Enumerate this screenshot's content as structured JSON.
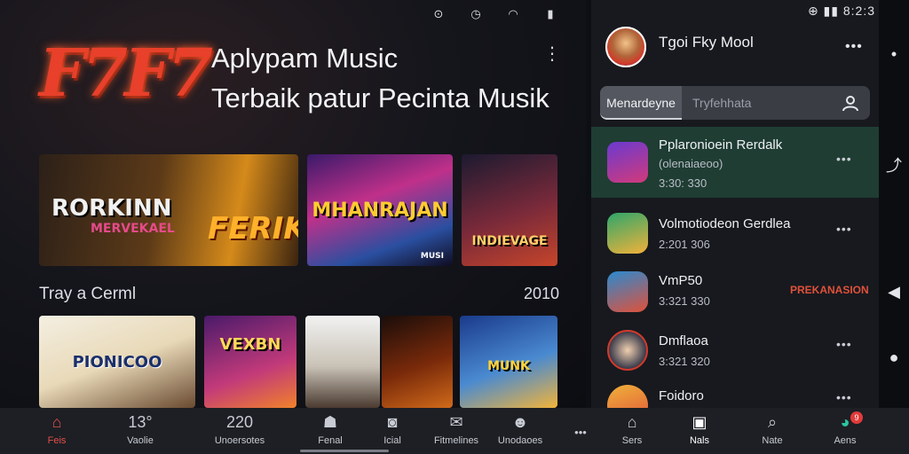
{
  "status_left": [
    "⊙",
    "◷",
    "◠",
    "▮"
  ],
  "status_right": "⊕ ▮▮ 8:2:3",
  "logo": "F7F7",
  "app": {
    "title_line1": "Aplypam Music",
    "title_line2": "Terbaik patur Pecinta Musik"
  },
  "featured": [
    {
      "title": "RORKINN",
      "subtitle": "MERVEKAEL",
      "overlay": "FERIK"
    },
    {
      "title": "MHANRAJAN",
      "tag": "MUSI"
    },
    {
      "title": "INDIEVAGE"
    }
  ],
  "section": {
    "label": "Tray a Cerml",
    "count": "2010"
  },
  "tiles": [
    {
      "title": "PIONICOO"
    },
    {
      "title": "VEXBN"
    },
    {
      "title": ""
    },
    {
      "title": ""
    },
    {
      "title": "MUNK"
    }
  ],
  "profile": {
    "name": "Tgoi Fky Mool"
  },
  "tabs": {
    "active": "Menardeyne",
    "inactive": "Tryfehhata"
  },
  "list": [
    {
      "title": "Pplaronioein Rerdalk",
      "sub": "(olenaiaeoo)",
      "sub2": "3:30: 330"
    },
    {
      "title": "Volmotiodeon Gerdlea",
      "sub": "2:201 306"
    },
    {
      "title": "VmP50",
      "sub": "3:321 330",
      "badge": "PREKANASION"
    },
    {
      "title": "Dmflaoa",
      "sub": "3:321 320"
    },
    {
      "title": "Foidoro"
    }
  ],
  "bottom_nav": [
    {
      "label": "Feis",
      "icon": "⌂"
    },
    {
      "label": "Vaolie",
      "icon": "13°"
    },
    {
      "label": "Unoersotes",
      "icon": "220"
    },
    {
      "label": "Fenal",
      "icon": "☗"
    },
    {
      "label": "Icial",
      "icon": "◙"
    },
    {
      "label": "Fitmelines",
      "icon": "✉"
    },
    {
      "label": "Unodaoes",
      "icon": "☻"
    },
    {
      "label": "",
      "icon": "•••"
    },
    {
      "label": "Sers",
      "icon": "⌂"
    },
    {
      "label": "Nals",
      "icon": "▣"
    },
    {
      "label": "Nate",
      "icon": "⌕"
    },
    {
      "label": "Aens",
      "icon": "◕",
      "badge": "9"
    }
  ],
  "colors": {
    "accent": "#e2504a",
    "active_row": "#1f3d33",
    "panel": "#17191e"
  }
}
